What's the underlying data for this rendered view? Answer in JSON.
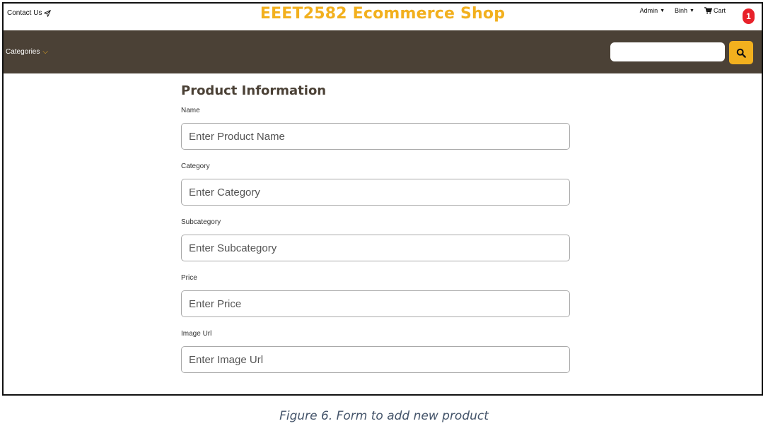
{
  "header": {
    "contact_label": "Contact Us",
    "shop_title": "EEET2582 Ecommerce Shop",
    "admin_label": "Admin",
    "user_label": "Binh",
    "cart_label": "Cart",
    "cart_count": "1"
  },
  "nav": {
    "categories_label": "Categories",
    "search_placeholder": ""
  },
  "form": {
    "title": "Product Information",
    "fields": [
      {
        "label": "Name",
        "placeholder": "Enter Product Name"
      },
      {
        "label": "Category",
        "placeholder": "Enter Category"
      },
      {
        "label": "Subcategory",
        "placeholder": "Enter Subcategory"
      },
      {
        "label": "Price",
        "placeholder": "Enter Price"
      },
      {
        "label": "Image Url",
        "placeholder": "Enter Image Url"
      }
    ]
  },
  "caption": "Figure 6. Form to add new product",
  "colors": {
    "brand_yellow": "#f2b01e",
    "nav_brown": "#4b4136",
    "badge_red": "#e8212a",
    "caption_blue": "#44546a"
  },
  "icons": [
    "send-icon",
    "caret-down-icon",
    "cart-icon",
    "chevron-down-icon",
    "search-icon"
  ]
}
